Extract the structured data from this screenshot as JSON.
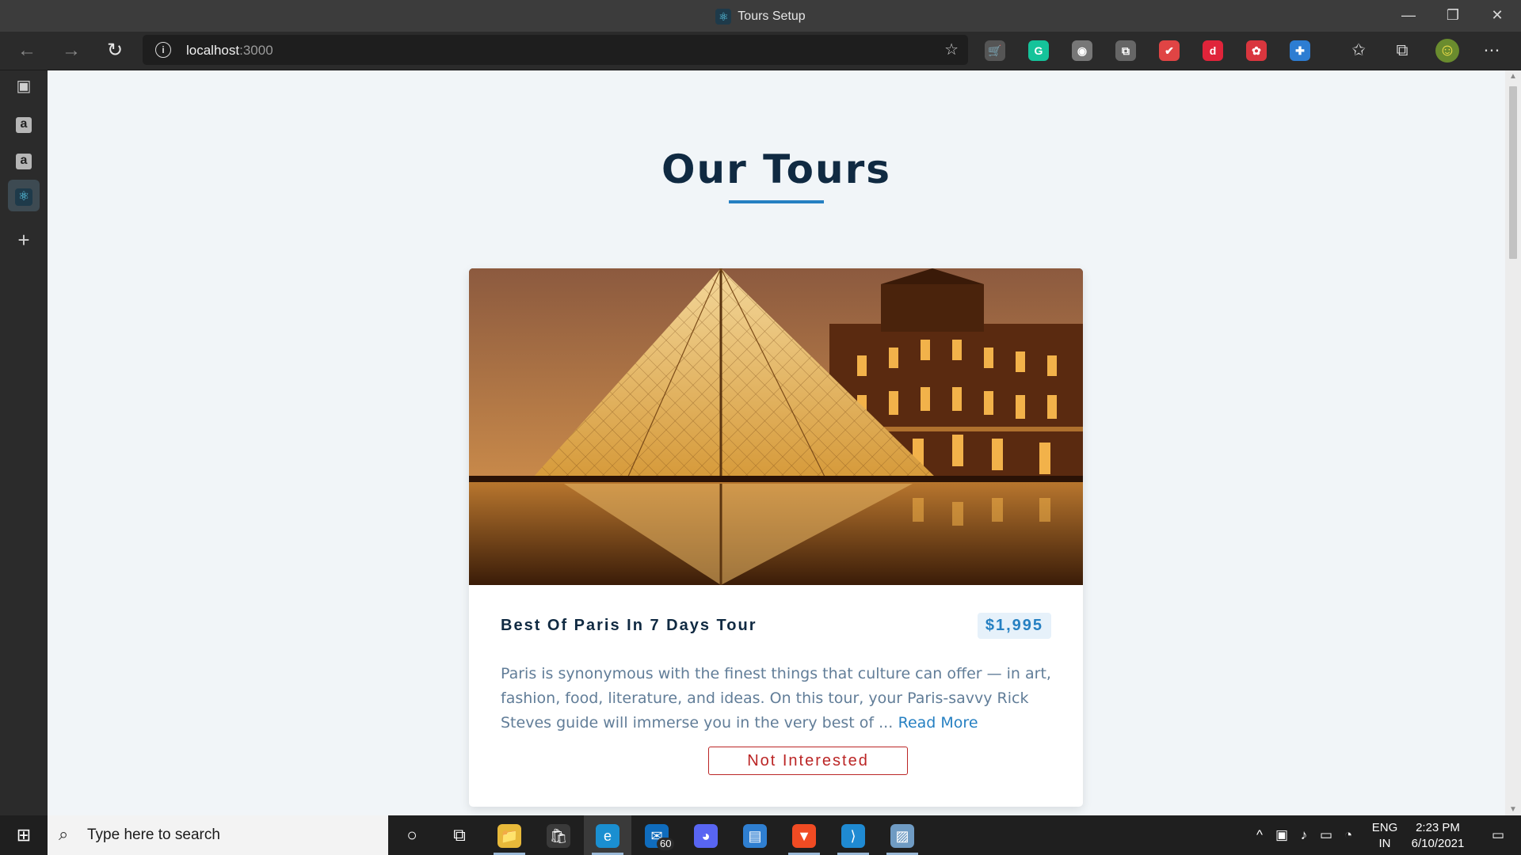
{
  "window": {
    "title": "Tours Setup",
    "minimize": "—",
    "restore": "❐",
    "close": "✕"
  },
  "toolbar": {
    "back": "←",
    "forward": "→",
    "reload": "↻",
    "url_host": "localhost",
    "url_port": ":3000",
    "info_icon": "i",
    "add_favorite": "☆",
    "extensions": [
      {
        "name": "cart-ext-icon",
        "glyph": "🛒",
        "color": "#555555"
      },
      {
        "name": "grammarly-icon",
        "glyph": "G",
        "color": "#15c39a"
      },
      {
        "name": "circle-ext-icon",
        "glyph": "◉",
        "color": "#777777"
      },
      {
        "name": "copy-ext-icon",
        "glyph": "⧉",
        "color": "#666666"
      },
      {
        "name": "color-ext-icon",
        "glyph": "✔",
        "color": "#e04444"
      },
      {
        "name": "d-ext-icon",
        "glyph": "d",
        "color": "#e0243a"
      },
      {
        "name": "red-ext-icon",
        "glyph": "✿",
        "color": "#d9363e"
      },
      {
        "name": "blue-ext-icon",
        "glyph": "✚",
        "color": "#2d7dd2"
      }
    ],
    "favorites_icon": "✩",
    "collections_icon": "⧉",
    "profile_glyph": "☺",
    "more_icon": "⋯"
  },
  "tabs": [
    {
      "name": "tab-actions",
      "glyph": "▣"
    },
    {
      "name": "tab-amazon-1",
      "glyph": "a"
    },
    {
      "name": "tab-amazon-2",
      "glyph": "a"
    },
    {
      "name": "tab-react",
      "glyph": "⚛"
    }
  ],
  "new_tab": "+",
  "page": {
    "heading": "Our Tours",
    "tour": {
      "name": "Best Of Paris In 7 Days Tour",
      "price": "$1,995",
      "description": "Paris is synonymous with the finest things that culture can offer — in art, fashion, food, literature, and ideas. On this tour, your Paris-savvy Rick Steves guide will immerse you in the very best of ...",
      "read_more": "Read More",
      "not_interested": "Not Interested"
    }
  },
  "taskbar": {
    "start": "⊞",
    "search_placeholder": "Type here to search",
    "search_icon": "⌕",
    "cortana": "○",
    "taskview": "⧉",
    "apps": [
      {
        "name": "file-explorer-icon",
        "glyph": "📁",
        "bg": "#e8b93a",
        "running": true
      },
      {
        "name": "store-icon",
        "glyph": "🛍",
        "bg": "#3a3a3a",
        "running": false
      },
      {
        "name": "edge-icon",
        "glyph": "e",
        "bg": "#1a8fd1",
        "running": true,
        "active": true
      },
      {
        "name": "mail-icon",
        "glyph": "✉",
        "bg": "#0f6cbd",
        "running": false,
        "badge": "60"
      },
      {
        "name": "discord-icon",
        "glyph": "◕",
        "bg": "#5865f2",
        "running": false
      },
      {
        "name": "news-icon",
        "glyph": "▤",
        "bg": "#2f7fd1",
        "running": false
      },
      {
        "name": "brave-icon",
        "glyph": "▼",
        "bg": "#f04b23",
        "running": true
      },
      {
        "name": "vscode-icon",
        "glyph": "⟩",
        "bg": "#1f8ad2",
        "running": true
      },
      {
        "name": "photos-icon",
        "glyph": "▨",
        "bg": "#6f9bc3",
        "running": true
      }
    ],
    "tray_chevron": "^",
    "lang_line1": "ENG",
    "lang_line2": "IN",
    "time": "2:23 PM",
    "date": "6/10/2021",
    "notifications_icon": "▭"
  }
}
